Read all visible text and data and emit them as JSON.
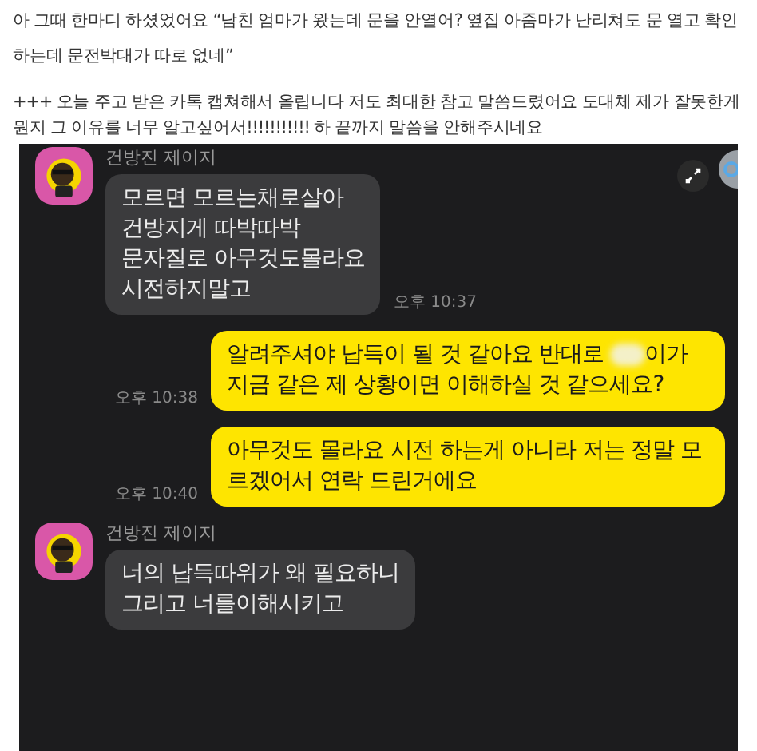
{
  "post": {
    "paragraphs": [
      "아 그때 한마디 하셨었어요 “남친 엄마가 왔는데 문을 안열어? 옆집 아줌마가 난리쳐도 문 열고 확인하는데 문전박대가 따로 없네”",
      "+++ 오늘 주고 받은 카톡 캡쳐해서 올립니다 저도 최대한 참고 말씀드렸어요 도대체 제가 잘못한게 뭔지 그 이유를 너무 알고싶어서!!!!!!!!!!! 하 끝까지 말씀을 안해주시네요"
    ]
  },
  "chat": {
    "messages": [
      {
        "kind": "received",
        "sender": "건방진 제이지",
        "text": "모르면 모르는채로살아\n건방지게 따박따박\n문자질로 아무것도몰라요\n시전하지말고",
        "time": "오후 10:37"
      },
      {
        "kind": "sent",
        "text_before": "알려주셔야 납득이 될 것 같아요 반대로 ",
        "redacted": true,
        "text_after": "이가 지금 같은 제 상황이면 이해하실 것 같으세요?",
        "time": "오후 10:38"
      },
      {
        "kind": "sent",
        "text_before": "아무것도 몰라요 시전 하는게 아니라 저는 정말 모르겠어서 연락 드린거에요",
        "time": "오후 10:40"
      },
      {
        "kind": "received",
        "sender": "건방진 제이지",
        "text": "너의 납득따위가 왜 필요하니\n그리고 너를이해시키고"
      }
    ]
  }
}
